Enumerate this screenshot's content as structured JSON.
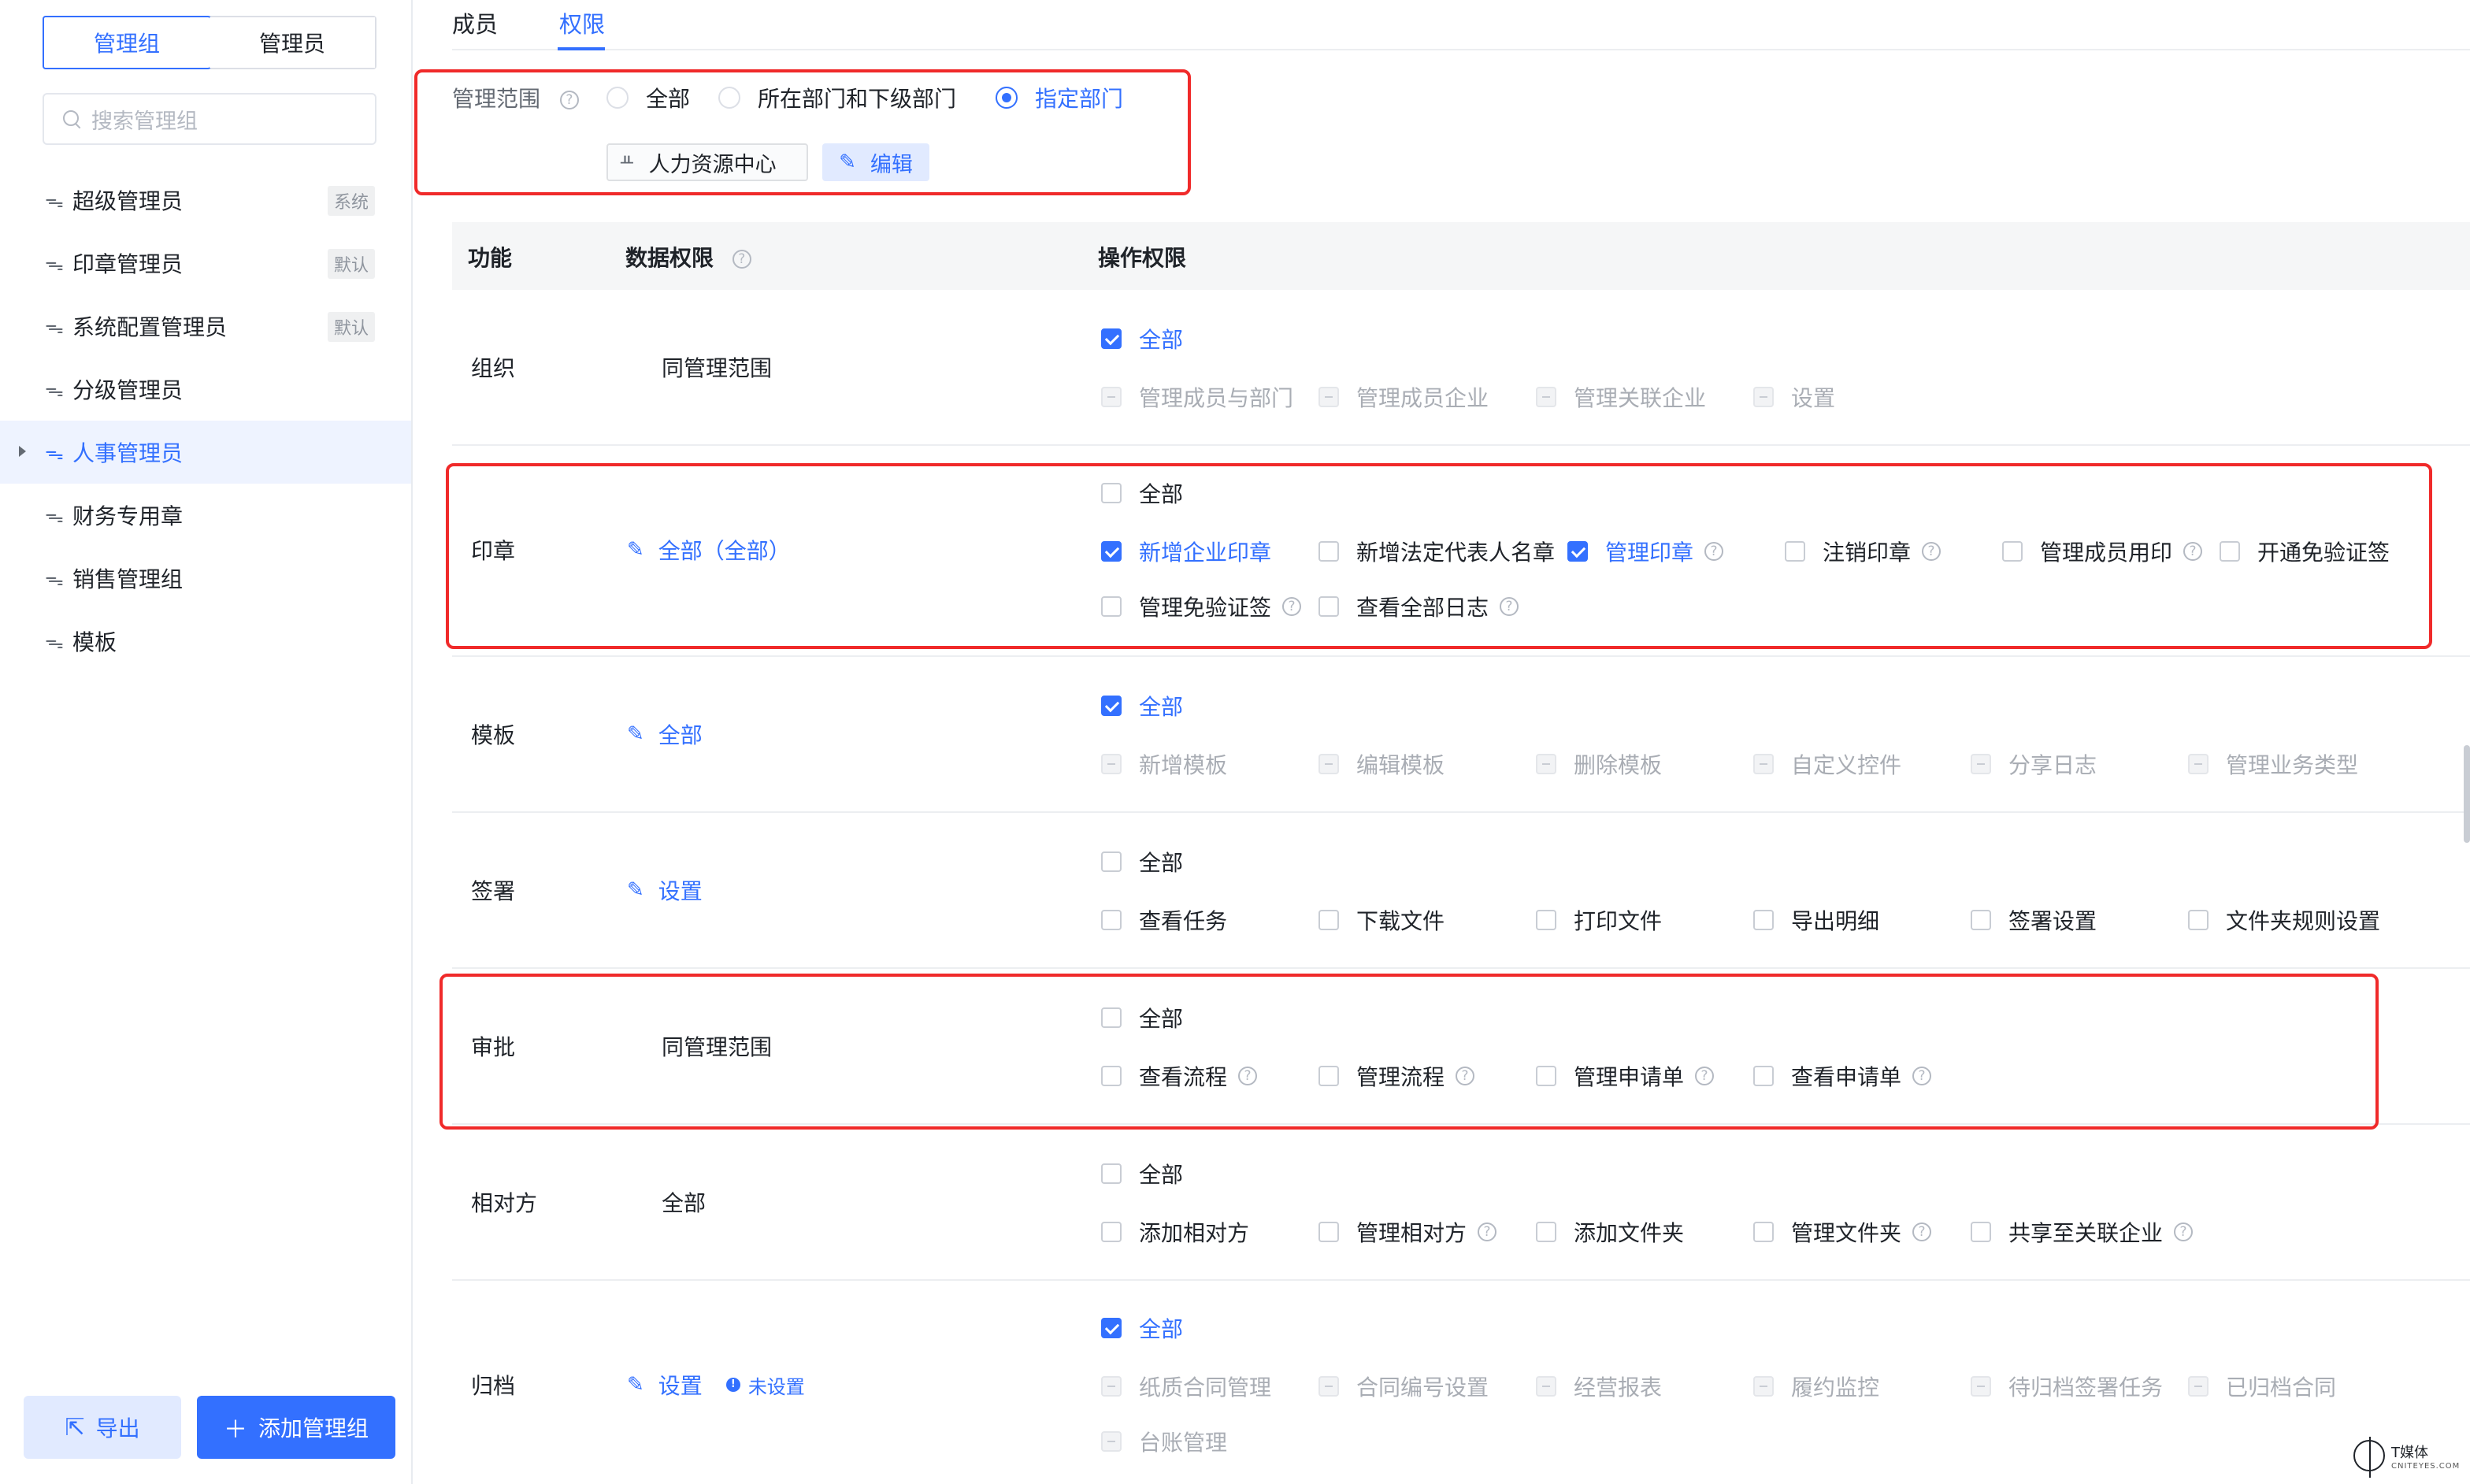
{
  "sidebar": {
    "segments": [
      "管理组",
      "管理员"
    ],
    "search_placeholder": "搜索管理组",
    "groups": [
      {
        "name": "超级管理员",
        "tag": "系统"
      },
      {
        "name": "印章管理员",
        "tag": "默认"
      },
      {
        "name": "系统配置管理员",
        "tag": "默认"
      },
      {
        "name": "分级管理员",
        "tag": ""
      },
      {
        "name": "人事管理员",
        "tag": "",
        "active": true
      },
      {
        "name": "财务专用章",
        "tag": ""
      },
      {
        "name": "销售管理组",
        "tag": ""
      },
      {
        "name": "模板",
        "tag": ""
      }
    ],
    "export_label": "导出",
    "add_label": "添加管理组"
  },
  "tabs": [
    "成员",
    "权限"
  ],
  "active_tab": "权限",
  "scope": {
    "label": "管理范围",
    "options": [
      "全部",
      "所在部门和下级部门",
      "指定部门"
    ],
    "selected": "指定部门",
    "dept": "人力资源中心",
    "edit_label": "编辑"
  },
  "table": {
    "headers": [
      "功能",
      "数据权限",
      "操作权限"
    ],
    "rows": [
      {
        "name": "组织",
        "data": "同管理范围",
        "perms": [
          {
            "label": "全部",
            "state": "checked"
          },
          {
            "label": "管理成员与部门",
            "state": "disabled"
          },
          {
            "label": "管理成员企业",
            "state": "disabled"
          },
          {
            "label": "管理关联企业",
            "state": "disabled"
          },
          {
            "label": "设置",
            "state": "disabled"
          }
        ]
      },
      {
        "name": "印章",
        "data": "全部（全部）",
        "perms": [
          {
            "label": "全部",
            "state": "unchecked"
          },
          {
            "label": "新增企业印章",
            "state": "checked"
          },
          {
            "label": "新增法定代表人名章",
            "state": "unchecked"
          },
          {
            "label": "管理印章",
            "state": "checked"
          },
          {
            "label": "注销印章",
            "state": "unchecked"
          },
          {
            "label": "管理成员用印",
            "state": "unchecked"
          },
          {
            "label": "开通免验证签",
            "state": "unchecked"
          },
          {
            "label": "管理免验证签",
            "state": "unchecked"
          },
          {
            "label": "查看全部日志",
            "state": "unchecked"
          }
        ]
      },
      {
        "name": "模板",
        "data": "全部",
        "perms": [
          {
            "label": "全部",
            "state": "checked"
          },
          {
            "label": "新增模板",
            "state": "disabled"
          },
          {
            "label": "编辑模板",
            "state": "disabled"
          },
          {
            "label": "删除模板",
            "state": "disabled"
          },
          {
            "label": "自定义控件",
            "state": "disabled"
          },
          {
            "label": "分享日志",
            "state": "disabled"
          },
          {
            "label": "管理业务类型",
            "state": "disabled"
          }
        ]
      },
      {
        "name": "签署",
        "data": "设置",
        "perms": [
          {
            "label": "全部",
            "state": "unchecked"
          },
          {
            "label": "查看任务",
            "state": "unchecked"
          },
          {
            "label": "下载文件",
            "state": "unchecked"
          },
          {
            "label": "打印文件",
            "state": "unchecked"
          },
          {
            "label": "导出明细",
            "state": "unchecked"
          },
          {
            "label": "签署设置",
            "state": "unchecked"
          },
          {
            "label": "文件夹规则设置",
            "state": "unchecked"
          }
        ]
      },
      {
        "name": "审批",
        "data": "同管理范围",
        "perms": [
          {
            "label": "全部",
            "state": "unchecked"
          },
          {
            "label": "查看流程",
            "state": "unchecked"
          },
          {
            "label": "管理流程",
            "state": "unchecked"
          },
          {
            "label": "管理申请单",
            "state": "unchecked"
          },
          {
            "label": "查看申请单",
            "state": "unchecked"
          }
        ]
      },
      {
        "name": "相对方",
        "data": "全部",
        "perms": [
          {
            "label": "全部",
            "state": "unchecked"
          },
          {
            "label": "添加相对方",
            "state": "unchecked"
          },
          {
            "label": "管理相对方",
            "state": "unchecked"
          },
          {
            "label": "添加文件夹",
            "state": "unchecked"
          },
          {
            "label": "管理文件夹",
            "state": "unchecked"
          },
          {
            "label": "共享至关联企业",
            "state": "unchecked"
          }
        ]
      },
      {
        "name": "归档",
        "data": "设置",
        "badge": "未设置",
        "perms": [
          {
            "label": "全部",
            "state": "checked"
          },
          {
            "label": "纸质合同管理",
            "state": "disabled"
          },
          {
            "label": "合同编号设置",
            "state": "disabled"
          },
          {
            "label": "经营报表",
            "state": "disabled"
          },
          {
            "label": "履约监控",
            "state": "disabled"
          },
          {
            "label": "待归档签署任务",
            "state": "disabled"
          },
          {
            "label": "已归档合同",
            "state": "disabled"
          },
          {
            "label": "台账管理",
            "state": "disabled"
          }
        ]
      }
    ]
  },
  "watermark": {
    "name": "T媒体",
    "site": "CNITEYES.COM"
  },
  "colors": {
    "accent": "#3370ff",
    "highlight_box": "#f02a2a"
  }
}
